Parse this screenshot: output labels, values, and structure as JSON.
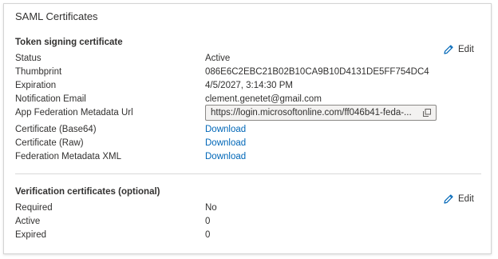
{
  "card": {
    "title": "SAML Certificates"
  },
  "token_signing": {
    "title": "Token signing certificate",
    "edit_label": "Edit",
    "rows": [
      {
        "label": "Status",
        "value": "Active"
      },
      {
        "label": "Thumbprint",
        "value": "086E6C2EBC21B02B10CA9B10D4131DE5FF754DC4"
      },
      {
        "label": "Expiration",
        "value": "4/5/2027, 3:14:30 PM"
      },
      {
        "label": "Notification Email",
        "value": "clement.genetet@gmail.com"
      },
      {
        "label": "App Federation Metadata Url",
        "value": "https://login.microsoftonline.com/ff046b41-feda-..."
      },
      {
        "label": "Certificate (Base64)",
        "value": "Download"
      },
      {
        "label": "Certificate (Raw)",
        "value": "Download"
      },
      {
        "label": "Federation Metadata XML",
        "value": "Download"
      }
    ]
  },
  "verification": {
    "title": "Verification certificates (optional)",
    "edit_label": "Edit",
    "rows": [
      {
        "label": "Required",
        "value": "No"
      },
      {
        "label": "Active",
        "value": "0"
      },
      {
        "label": "Expired",
        "value": "0"
      }
    ]
  },
  "icons": {
    "edit": "pencil-icon",
    "copy": "copy-icon"
  },
  "colors": {
    "link": "#0067b8",
    "edit_icon": "#0067b8",
    "border": "#d4d4d4"
  }
}
